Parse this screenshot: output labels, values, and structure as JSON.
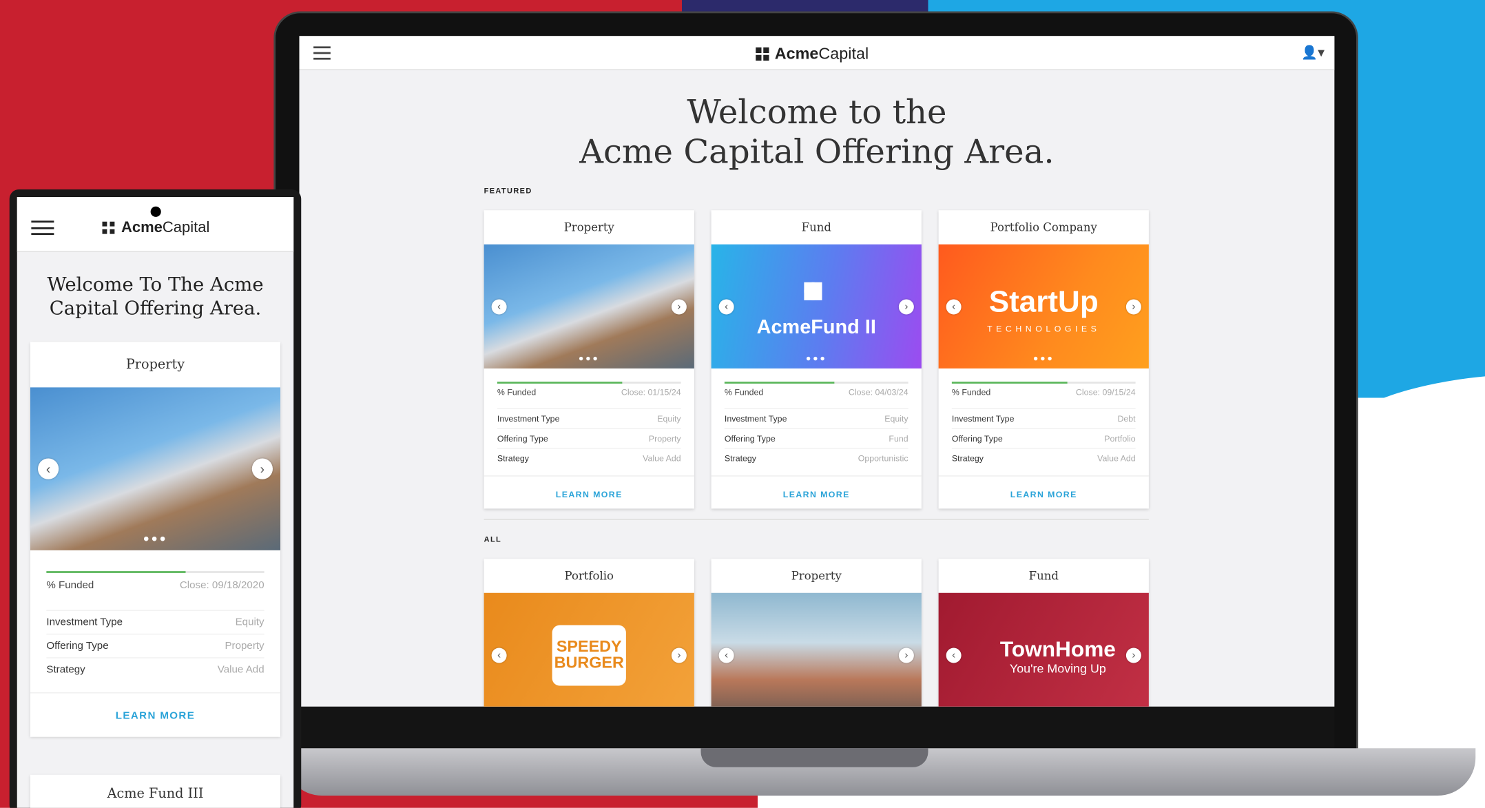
{
  "laptop": {
    "brand": {
      "bold": "Acme",
      "light": "Capital"
    },
    "title_line1": "Welcome to the",
    "title_line2": "Acme Capital Offering Area.",
    "featured_label": "FEATURED",
    "all_label": "ALL",
    "featured": [
      {
        "category": "Property",
        "close": "Close: 01/15/24",
        "funded_label": "% Funded",
        "funded_pct": 68,
        "rows": [
          [
            "Investment Type",
            "Equity"
          ],
          [
            "Offering Type",
            "Property"
          ],
          [
            "Strategy",
            "Value Add"
          ]
        ],
        "cta": "LEARN MORE"
      },
      {
        "category": "Fund",
        "close": "Close: 04/03/24",
        "funded_label": "% Funded",
        "funded_pct": 60,
        "image_text": "AcmeFund II",
        "rows": [
          [
            "Investment Type",
            "Equity"
          ],
          [
            "Offering Type",
            "Fund"
          ],
          [
            "Strategy",
            "Opportunistic"
          ]
        ],
        "cta": "LEARN MORE"
      },
      {
        "category": "Portfolio Company",
        "close": "Close: 09/15/24",
        "funded_label": "% Funded",
        "funded_pct": 63,
        "image_text": "StartUp",
        "image_subtext": "TECHNOLOGIES",
        "rows": [
          [
            "Investment Type",
            "Debt"
          ],
          [
            "Offering Type",
            "Portfolio"
          ],
          [
            "Strategy",
            "Value Add"
          ]
        ],
        "cta": "LEARN MORE"
      }
    ],
    "all": [
      {
        "category": "Portfolio",
        "image_text": "SPEEDY BURGER"
      },
      {
        "category": "Property"
      },
      {
        "category": "Fund",
        "image_text": "TownHome",
        "image_subtext": "You're Moving Up"
      }
    ]
  },
  "phone": {
    "brand": {
      "bold": "Acme",
      "light": "Capital"
    },
    "title_line1": "Welcome To The Acme",
    "title_line2": "Capital Offering Area.",
    "card": {
      "category": "Property",
      "funded_label": "% Funded",
      "close": "Close: 09/18/2020",
      "funded_pct": 64,
      "rows": [
        [
          "Investment Type",
          "Equity"
        ],
        [
          "Offering Type",
          "Property"
        ],
        [
          "Strategy",
          "Value Add"
        ]
      ],
      "cta": "LEARN MORE"
    },
    "next_card": "Acme Fund III"
  },
  "colors": {
    "accent": "#2aa3d8",
    "progress": "#5cb85c",
    "bg_red": "#c8202f",
    "bg_blue": "#1ea7e4"
  },
  "icons": [
    "hamburger-menu-icon",
    "logo-icon",
    "user-account-icon",
    "chevron-left-icon",
    "chevron-right-icon",
    "carousel-dots-icon"
  ]
}
